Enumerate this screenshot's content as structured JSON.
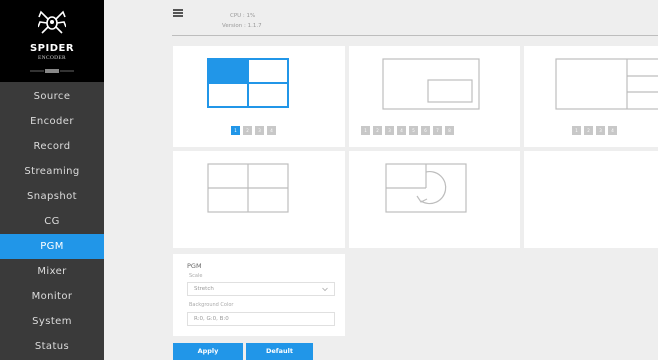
{
  "brand": {
    "name": "SPIDER",
    "product": "ENCODER",
    "icon": "spider-logo-icon"
  },
  "header": {
    "cpu": "CPU : 1%",
    "version": "Version : 1.1.7",
    "menu_icon": "hamburger-icon"
  },
  "sidebar": {
    "items": [
      {
        "label": "Source"
      },
      {
        "label": "Encoder"
      },
      {
        "label": "Record"
      },
      {
        "label": "Streaming"
      },
      {
        "label": "Snapshot"
      },
      {
        "label": "CG"
      },
      {
        "label": "PGM",
        "active": true
      },
      {
        "label": "Mixer"
      },
      {
        "label": "Monitor"
      },
      {
        "label": "System"
      },
      {
        "label": "Status"
      }
    ]
  },
  "layouts": [
    {
      "name": "quad-split",
      "selected": true,
      "pages": [
        "1",
        "2",
        "3",
        "4"
      ],
      "active_page": "1"
    },
    {
      "name": "pip",
      "pages": [
        "1",
        "2",
        "3",
        "4",
        "5",
        "6",
        "7",
        "8"
      ]
    },
    {
      "name": "one-plus-three",
      "pages": [
        "1",
        "2",
        "3",
        "4"
      ]
    },
    {
      "name": "quad-outline",
      "pages": []
    },
    {
      "name": "rotate",
      "pages": []
    }
  ],
  "pgm": {
    "title": "PGM",
    "scale_label": "Scale",
    "scale_value": "Stretch",
    "bg_label": "Background Color",
    "bg_value": "R:0, G:0, B:0"
  },
  "actions": {
    "apply": "Apply",
    "default": "Default"
  },
  "colors": {
    "accent": "#2196e8",
    "sidebar": "#3a3a3a",
    "logo_bg": "#000000"
  }
}
